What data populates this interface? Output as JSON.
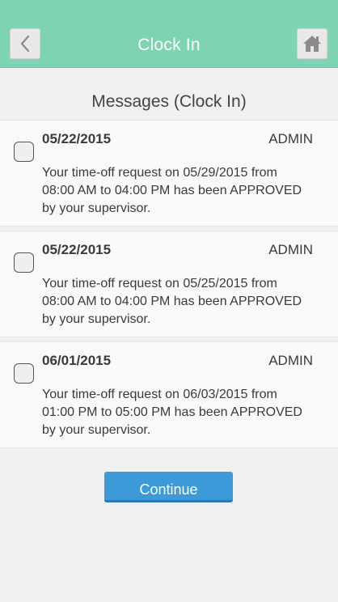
{
  "header": {
    "title": "Clock In",
    "back_icon": "chevron-left-icon",
    "home_icon": "home-icon",
    "background_color": "#7dd3b2"
  },
  "section": {
    "title": "Messages (Clock In)"
  },
  "messages": [
    {
      "date": "05/22/2015",
      "sender": "ADMIN",
      "body": "Your time-off request on 05/29/2015 from 08:00 AM to 04:00 PM has been APPROVED by your supervisor.",
      "checked": false
    },
    {
      "date": "05/22/2015",
      "sender": "ADMIN",
      "body": "Your time-off request on 05/25/2015 from 08:00 AM to 04:00 PM has been APPROVED by your supervisor.",
      "checked": false
    },
    {
      "date": "06/01/2015",
      "sender": "ADMIN",
      "body": "Your time-off request on 06/03/2015 from 01:00 PM to 05:00 PM has been APPROVED by your supervisor.",
      "checked": false
    }
  ],
  "actions": {
    "continue_label": "Continue",
    "continue_color": "#3d9ad9"
  }
}
